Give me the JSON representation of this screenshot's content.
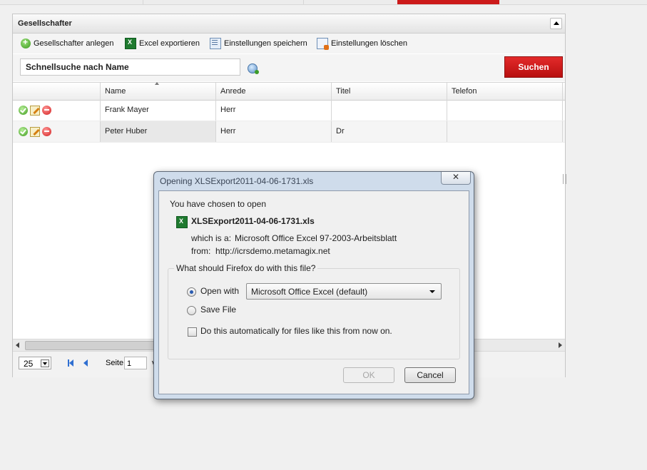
{
  "panel": {
    "title": "Gesellschafter"
  },
  "toolbar": {
    "add_label": "Gesellschafter anlegen",
    "export_label": "Excel exportieren",
    "save_settings_label": "Einstellungen speichern",
    "delete_settings_label": "Einstellungen löschen"
  },
  "search": {
    "placeholder": "Schnellsuche nach Name",
    "button_label": "Suchen"
  },
  "grid": {
    "columns": [
      "",
      "Name",
      "Anrede",
      "Titel",
      "Telefon"
    ],
    "rows": [
      {
        "name": "Frank Mayer",
        "anrede": "Herr",
        "titel": "",
        "telefon": ""
      },
      {
        "name": "Peter Huber",
        "anrede": "Herr",
        "titel": "Dr",
        "telefon": ""
      }
    ]
  },
  "pager": {
    "page_size": "25",
    "page_label": "Seite",
    "page_value": "1",
    "trailing": "v"
  },
  "dialog": {
    "title": "Opening XLSExport2011-04-06-1731.xls",
    "close_label": "✕",
    "intro": "You have chosen to open",
    "file_name": "XLSExport2011-04-06-1731.xls",
    "which_label": "which is a:",
    "which_value": "Microsoft Office Excel 97-2003-Arbeitsblatt",
    "from_label": "from:",
    "from_value": "http://icrsdemo.metamagix.net",
    "question": "What should Firefox do with this file?",
    "open_with_label": "Open with",
    "open_with_app": "Microsoft Office Excel (default)",
    "save_file_label": "Save File",
    "auto_label": "Do this automatically for files like this from now on.",
    "ok_label": "OK",
    "cancel_label": "Cancel"
  },
  "colors": {
    "accent_red": "#cc1a1a",
    "dialog_frame": "#cfdceb"
  }
}
